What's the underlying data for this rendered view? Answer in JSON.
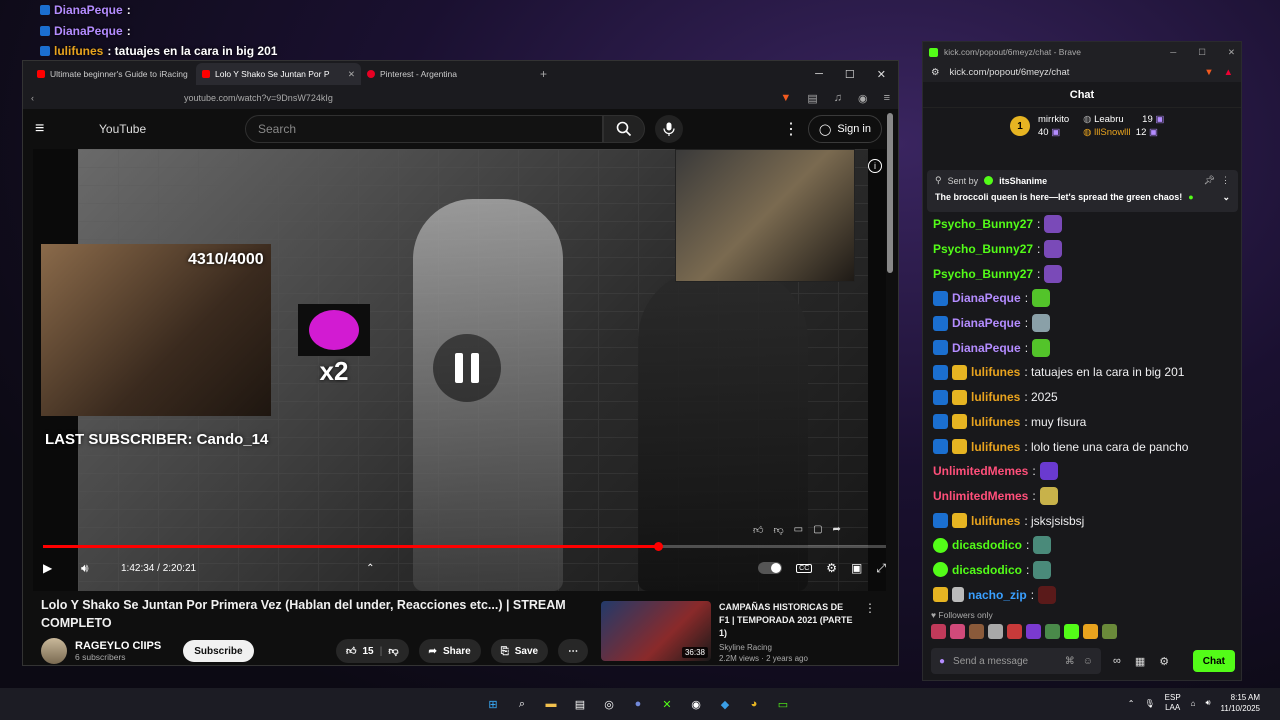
{
  "overlay_chat": [
    {
      "name": "DianaPeque",
      "text": ":",
      "color": "#b48cff"
    },
    {
      "name": "DianaPeque",
      "text": ":",
      "color": "#b48cff"
    },
    {
      "name": "lulifunes",
      "text": ": tatuajes en la cara in big 201",
      "color": "#e8a31e"
    },
    {
      "name": "lulifunes",
      "text": ": 2025",
      "color": "#e8a31e"
    },
    {
      "name": "lulifunes",
      "text": ": muy fisura",
      "color": "#e8a31e"
    },
    {
      "name": "lulifunes",
      "text": ": lolo tiene una cara de pancho",
      "color": "#e8a31e"
    },
    {
      "name": "UnlimitedMemes",
      "text": ":",
      "color": "#ff4f7a"
    },
    {
      "name": "UnlimitedMemes",
      "text": ":",
      "color": "#ff4f7a"
    },
    {
      "name": "lulifunes",
      "text": ": jsksjsisbsj",
      "color": "#e8a31e"
    },
    {
      "name": "dicasdodico",
      "text": ":",
      "color": "#ffffff"
    },
    {
      "name": "dicasdodico",
      "text": ":",
      "color": "#ffffff"
    },
    {
      "name": "nacho_zip",
      "text": ":",
      "color": "#3aa0ff"
    }
  ],
  "youtube": {
    "tabs": [
      {
        "label": "Ultimate beginner's Guide to iRacing",
        "active": false
      },
      {
        "label": "Lolo Y Shako Se Juntan Por P",
        "active": true
      },
      {
        "label": "Pinterest - Argentina",
        "active": false
      }
    ],
    "url": "youtube.com/watch?v=9DnsW724kIg",
    "search_placeholder": "Search",
    "sign_in": "Sign in",
    "logo": "YouTube",
    "overlay": {
      "sub_goal": "4310/4000",
      "last_subscriber": "LAST SUBSCRIBER: Cando_14",
      "multiplier": "x2"
    },
    "progress_fraction": 0.73,
    "time": "1:42:34 / 2:20:21",
    "title": "Lolo Y Shako Se Juntan Por Primera Vez (Hablan del under, Reacciones etc...) | STREAM COMPLETO",
    "channel": "RAGEYLO ClIPS",
    "subscribers": "6 subscribers",
    "subscribe": "Subscribe",
    "likes": "15",
    "share": "Share",
    "save": "Save",
    "recommended": {
      "title": "CAMPAÑAS HISTORICAS DE F1 | TEMPORADA 2021 (PARTE 1)",
      "channel": "Skyline Racing",
      "meta": "2.2M views · 2 years ago",
      "duration": "36:38"
    }
  },
  "kick": {
    "window_title": "kick.com/popout/6meyz/chat - Brave",
    "url": "kick.com/popout/6meyz/chat",
    "header": "Chat",
    "leaderboard": [
      {
        "name": "mirrkito",
        "value": "40",
        "rank": "1"
      },
      {
        "name": "Leabru",
        "value": "19"
      },
      {
        "name": "lllSnowlll",
        "value": "12"
      }
    ],
    "pinned": {
      "sent_by_label": "Sent by",
      "sender": "itsShanime",
      "message": "The broccoli queen is here—let's spread the green chaos!"
    },
    "messages": [
      {
        "badges": [],
        "name": "Psycho_Bunny27",
        "text": ":",
        "color": "#53fc18",
        "emote": "#7a4ab8"
      },
      {
        "badges": [],
        "name": "Psycho_Bunny27",
        "text": ":",
        "color": "#53fc18",
        "emote": "#7a4ab8"
      },
      {
        "badges": [],
        "name": "Psycho_Bunny27",
        "text": ":",
        "color": "#53fc18",
        "emote": "#7a4ab8"
      },
      {
        "badges": [
          "blue"
        ],
        "name": "DianaPeque",
        "text": ":",
        "color": "#b48cff",
        "emote": "#53c42a"
      },
      {
        "badges": [
          "blue"
        ],
        "name": "DianaPeque",
        "text": ":",
        "color": "#b48cff",
        "emote": "#8aa0a8"
      },
      {
        "badges": [
          "blue"
        ],
        "name": "DianaPeque",
        "text": ":",
        "color": "#b48cff",
        "emote": "#53c42a"
      },
      {
        "badges": [
          "blue",
          "crown"
        ],
        "name": "lulifunes",
        "text": ": tatuajes en la cara in big 201",
        "color": "#e8a31e"
      },
      {
        "badges": [
          "blue",
          "crown"
        ],
        "name": "lulifunes",
        "text": ": 2025",
        "color": "#e8a31e"
      },
      {
        "badges": [
          "blue",
          "crown"
        ],
        "name": "lulifunes",
        "text": ": muy fisura",
        "color": "#e8a31e"
      },
      {
        "badges": [
          "blue",
          "crown"
        ],
        "name": "lulifunes",
        "text": ": lolo tiene una cara de pancho",
        "color": "#e8a31e"
      },
      {
        "badges": [],
        "name": "UnlimitedMemes",
        "text": ":",
        "color": "#ff4f7a",
        "emote": "#6a3ad0"
      },
      {
        "badges": [],
        "name": "UnlimitedMemes",
        "text": ":",
        "color": "#ff4f7a",
        "emote": "#c8b24a"
      },
      {
        "badges": [
          "blue",
          "crown"
        ],
        "name": "lulifunes",
        "text": ": jsksjsisbsj",
        "color": "#e8a31e"
      },
      {
        "badges": [
          "green"
        ],
        "name": "dicasdodico",
        "text": ":",
        "color": "#53fc18",
        "emote": "#4a8a7a"
      },
      {
        "badges": [
          "green"
        ],
        "name": "dicasdodico",
        "text": ":",
        "color": "#53fc18",
        "emote": "#4a8a7a"
      },
      {
        "badges": [
          "crown",
          "gray"
        ],
        "name": "nacho_zip",
        "text": ":",
        "color": "#3aa0ff",
        "emote": "#5a1a1a"
      }
    ],
    "followers_only": "Followers only",
    "input_placeholder": "Send a message",
    "send": "Chat"
  },
  "taskbar": {
    "lang_top": "ESP",
    "lang_bottom": "LAA",
    "time": "8:15 AM",
    "date": "11/10/2025"
  }
}
